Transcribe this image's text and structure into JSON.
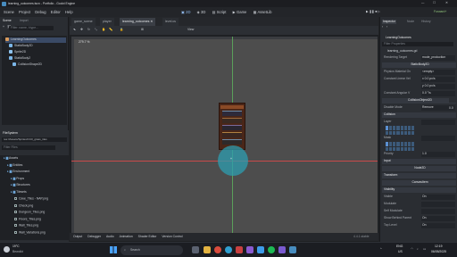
{
  "window": {
    "title": "learning_outcomes.tscn - Portfolio - Godot Engine",
    "status_right": "Forward+"
  },
  "menu": [
    "Scene",
    "Project",
    "Debug",
    "Editor",
    "Help"
  ],
  "modes": [
    "2D",
    "3D",
    "Script",
    "Game",
    "AssetLib"
  ],
  "scene_tabs": [
    "game_scene",
    "player",
    "learning_outcomes",
    "level.cs"
  ],
  "scene_panel": {
    "tabs": [
      "Scene",
      "Import"
    ],
    "filter_placeholder": "Filter: name, t:type...",
    "nodes": [
      {
        "label": "LearningOutcomes",
        "color": "#d99b5c",
        "indent": 0
      },
      {
        "label": "StaticBody2D",
        "color": "#7bb6e8",
        "indent": 1
      },
      {
        "label": "Sprite2D",
        "color": "#8fc4f0",
        "indent": 1
      },
      {
        "label": "StaticBody2",
        "color": "#7bb6e8",
        "indent": 1
      },
      {
        "label": "CollisionShape2D",
        "color": "#7bb6e8",
        "indent": 2
      }
    ]
  },
  "filesystem": {
    "title": "FileSystem",
    "path": "res://Assets/Sprites/CC0_grass_tiles",
    "filter_placeholder": "Filter Files",
    "items": [
      {
        "label": "Assets",
        "type": "folder",
        "indent": 0
      },
      {
        "label": "Entities",
        "type": "folder",
        "indent": 1
      },
      {
        "label": "Environment",
        "type": "folder",
        "indent": 1
      },
      {
        "label": "Props",
        "type": "folder",
        "indent": 2
      },
      {
        "label": "Structures",
        "type": "folder",
        "indent": 2
      },
      {
        "label": "Tilesets",
        "type": "folder",
        "indent": 2
      },
      {
        "label": "Cave_Tiles - NAP.png",
        "type": "file",
        "indent": 3
      },
      {
        "label": "Check.png",
        "type": "file",
        "indent": 3
      },
      {
        "label": "Dungeon_Tiles.png",
        "type": "file",
        "indent": 3
      },
      {
        "label": "Floors_Tiles.png",
        "type": "file",
        "indent": 3
      },
      {
        "label": "Wall_Tiles.png",
        "type": "file",
        "indent": 3
      },
      {
        "label": "Wall_Variations.png",
        "type": "file",
        "indent": 3
      }
    ]
  },
  "toolbar": {
    "view_label": "View",
    "zoom": "279.7 %"
  },
  "bottom_tabs": [
    "Output",
    "Debugger",
    "Audio",
    "Animation",
    "Shader Editor",
    "Version Control"
  ],
  "bottom_version": "4.4.1.stable",
  "inspector": {
    "tabs": [
      "Inspector",
      "Node",
      "History"
    ],
    "object": "LearningOutcomes",
    "filter": "Filter Properties",
    "resource": "learning_outcomes.gd",
    "rows": [
      {
        "label": "Rendering Target",
        "value": "mode_production"
      },
      {
        "label": "",
        "value": "StaticBody2D",
        "section": true
      },
      {
        "label": "Physics Material Ov",
        "value": "<empty>"
      },
      {
        "label": "Constant Linear Vel",
        "value": "x 0.0  px/s"
      },
      {
        "label": "",
        "value": "y 0.0  px/s"
      },
      {
        "label": "Constant Angular V",
        "value": "0.0  °/s"
      },
      {
        "label": "",
        "value": "CollisionObject2D",
        "section": true
      },
      {
        "label": "Disable Mode",
        "value": "Remove"
      },
      {
        "label": "Collision",
        "value": "",
        "section": true
      },
      {
        "label": "Layer",
        "value": ""
      },
      {
        "label": "Mask",
        "value": ""
      },
      {
        "label": "Priority",
        "value": "1.0"
      },
      {
        "label": "Input",
        "value": "",
        "section": true
      },
      {
        "label": "",
        "value": "Node2D",
        "section": true
      },
      {
        "label": "Transform",
        "value": "",
        "section": true
      },
      {
        "label": "",
        "value": "CanvasItem",
        "section": true
      },
      {
        "label": "Visibility",
        "value": "",
        "section": true
      },
      {
        "label": "Visible",
        "value": "On"
      },
      {
        "label": "Modulate",
        "value": ""
      },
      {
        "label": "Self Modulate",
        "value": ""
      },
      {
        "label": "Show Behind Parent",
        "value": "On"
      },
      {
        "label": "Top Level",
        "value": "On"
      }
    ],
    "side_value": "0.0"
  },
  "taskbar": {
    "weather_temp": "19°C",
    "weather_desc": "Bewolkt",
    "search": "Search",
    "lang": "ENG",
    "lang2": "US",
    "time": "12:19",
    "date": "06/05/2025"
  },
  "colors": {
    "accent": "#4a90d9",
    "circle": "#2d9db0",
    "lib_dark": "#4a2618",
    "lib_trim": "#8a4a26"
  }
}
